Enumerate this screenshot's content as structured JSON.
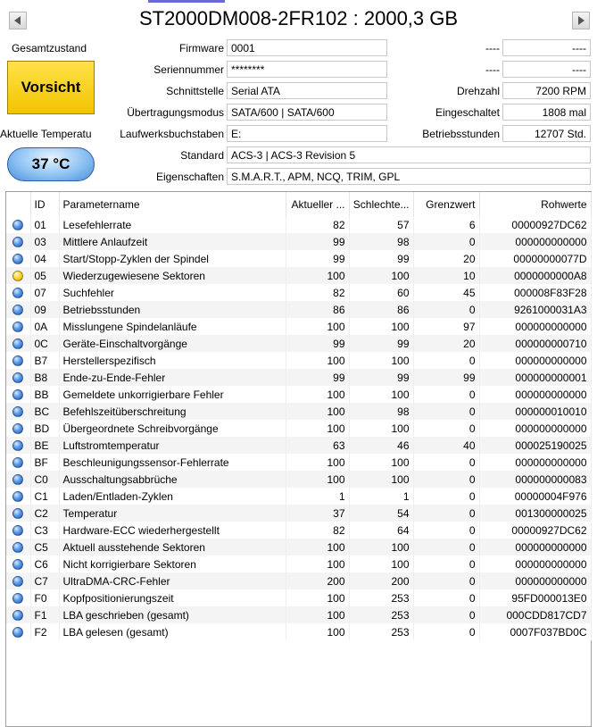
{
  "disk": {
    "title": "ST2000DM008-2FR102 : 2000,3 GB"
  },
  "health": {
    "label": "Gesamtzustand",
    "status": "Vorsicht",
    "status_color": "#f2c400"
  },
  "temperature": {
    "label": "Aktuelle Temperatu",
    "value": "37 °C"
  },
  "info": {
    "firmware_label": "Firmware",
    "firmware": "0001",
    "serial_label": "Seriennummer",
    "serial": "********",
    "interface_label": "Schnittstelle",
    "interface": "Serial ATA",
    "transfer_label": "Übertragungsmodus",
    "transfer": "SATA/600 | SATA/600",
    "drive_letter_label": "Laufwerksbuchstaben",
    "drive_letter": "E:",
    "standard_label": "Standard",
    "standard": "ACS-3 | ACS-3 Revision 5",
    "features_label": "Eigenschaften",
    "features": "S.M.A.R.T., APM, NCQ, TRIM, GPL",
    "right1_label": "----",
    "right1_value": "----",
    "right2_label": "----",
    "right2_value": "----",
    "rpm_label": "Drehzahl",
    "rpm": "7200 RPM",
    "power_count_label": "Eingeschaltet",
    "power_count": "1808 mal",
    "hours_label": "Betriebsstunden",
    "hours": "12707 Std."
  },
  "table": {
    "headers": [
      "ID",
      "Parametername",
      "Aktueller ...",
      "Schlechte...",
      "Grenzwert",
      "Rohwerte"
    ],
    "status_colors": {
      "good": "#3a7ad8",
      "caution": "#f0c000"
    },
    "rows": [
      {
        "status": "good",
        "id": "01",
        "name": "Lesefehlerrate",
        "current": "82",
        "worst": "57",
        "threshold": "6",
        "raw": "00000927DC62"
      },
      {
        "status": "good",
        "id": "03",
        "name": "Mittlere Anlaufzeit",
        "current": "99",
        "worst": "98",
        "threshold": "0",
        "raw": "000000000000"
      },
      {
        "status": "good",
        "id": "04",
        "name": "Start/Stopp-Zyklen der Spindel",
        "current": "99",
        "worst": "99",
        "threshold": "20",
        "raw": "00000000077D"
      },
      {
        "status": "caution",
        "id": "05",
        "name": "Wiederzugewiesene Sektoren",
        "current": "100",
        "worst": "100",
        "threshold": "10",
        "raw": "0000000000A8"
      },
      {
        "status": "good",
        "id": "07",
        "name": "Suchfehler",
        "current": "82",
        "worst": "60",
        "threshold": "45",
        "raw": "000008F83F28"
      },
      {
        "status": "good",
        "id": "09",
        "name": "Betriebsstunden",
        "current": "86",
        "worst": "86",
        "threshold": "0",
        "raw": "9261000031A3"
      },
      {
        "status": "good",
        "id": "0A",
        "name": "Misslungene Spindelanläufe",
        "current": "100",
        "worst": "100",
        "threshold": "97",
        "raw": "000000000000"
      },
      {
        "status": "good",
        "id": "0C",
        "name": "Geräte-Einschaltvorgänge",
        "current": "99",
        "worst": "99",
        "threshold": "20",
        "raw": "000000000710"
      },
      {
        "status": "good",
        "id": "B7",
        "name": "Herstellerspezifisch",
        "current": "100",
        "worst": "100",
        "threshold": "0",
        "raw": "000000000000"
      },
      {
        "status": "good",
        "id": "B8",
        "name": "Ende-zu-Ende-Fehler",
        "current": "99",
        "worst": "99",
        "threshold": "99",
        "raw": "000000000001"
      },
      {
        "status": "good",
        "id": "BB",
        "name": "Gemeldete unkorrigierbare Fehler",
        "current": "100",
        "worst": "100",
        "threshold": "0",
        "raw": "000000000000"
      },
      {
        "status": "good",
        "id": "BC",
        "name": "Befehlszeitüberschreitung",
        "current": "100",
        "worst": "98",
        "threshold": "0",
        "raw": "000000010010"
      },
      {
        "status": "good",
        "id": "BD",
        "name": "Übergeordnete Schreibvorgänge",
        "current": "100",
        "worst": "100",
        "threshold": "0",
        "raw": "000000000000"
      },
      {
        "status": "good",
        "id": "BE",
        "name": "Luftstromtemperatur",
        "current": "63",
        "worst": "46",
        "threshold": "40",
        "raw": "000025190025"
      },
      {
        "status": "good",
        "id": "BF",
        "name": "Beschleunigungssensor-Fehlerrate",
        "current": "100",
        "worst": "100",
        "threshold": "0",
        "raw": "000000000000"
      },
      {
        "status": "good",
        "id": "C0",
        "name": "Ausschaltungsabbrüche",
        "current": "100",
        "worst": "100",
        "threshold": "0",
        "raw": "000000000083"
      },
      {
        "status": "good",
        "id": "C1",
        "name": "Laden/Entladen-Zyklen",
        "current": "1",
        "worst": "1",
        "threshold": "0",
        "raw": "00000004F976"
      },
      {
        "status": "good",
        "id": "C2",
        "name": "Temperatur",
        "current": "37",
        "worst": "54",
        "threshold": "0",
        "raw": "001300000025"
      },
      {
        "status": "good",
        "id": "C3",
        "name": "Hardware-ECC wiederhergestellt",
        "current": "82",
        "worst": "64",
        "threshold": "0",
        "raw": "00000927DC62"
      },
      {
        "status": "good",
        "id": "C5",
        "name": "Aktuell ausstehende Sektoren",
        "current": "100",
        "worst": "100",
        "threshold": "0",
        "raw": "000000000000"
      },
      {
        "status": "good",
        "id": "C6",
        "name": "Nicht korrigierbare Sektoren",
        "current": "100",
        "worst": "100",
        "threshold": "0",
        "raw": "000000000000"
      },
      {
        "status": "good",
        "id": "C7",
        "name": "UltraDMA-CRC-Fehler",
        "current": "200",
        "worst": "200",
        "threshold": "0",
        "raw": "000000000000"
      },
      {
        "status": "good",
        "id": "F0",
        "name": "Kopfpositionierungszeit",
        "current": "100",
        "worst": "253",
        "threshold": "0",
        "raw": "95FD000013E0"
      },
      {
        "status": "good",
        "id": "F1",
        "name": "LBA geschrieben (gesamt)",
        "current": "100",
        "worst": "253",
        "threshold": "0",
        "raw": "000CDD817CD7"
      },
      {
        "status": "good",
        "id": "F2",
        "name": "LBA gelesen (gesamt)",
        "current": "100",
        "worst": "253",
        "threshold": "0",
        "raw": "0007F037BD0C"
      }
    ]
  }
}
